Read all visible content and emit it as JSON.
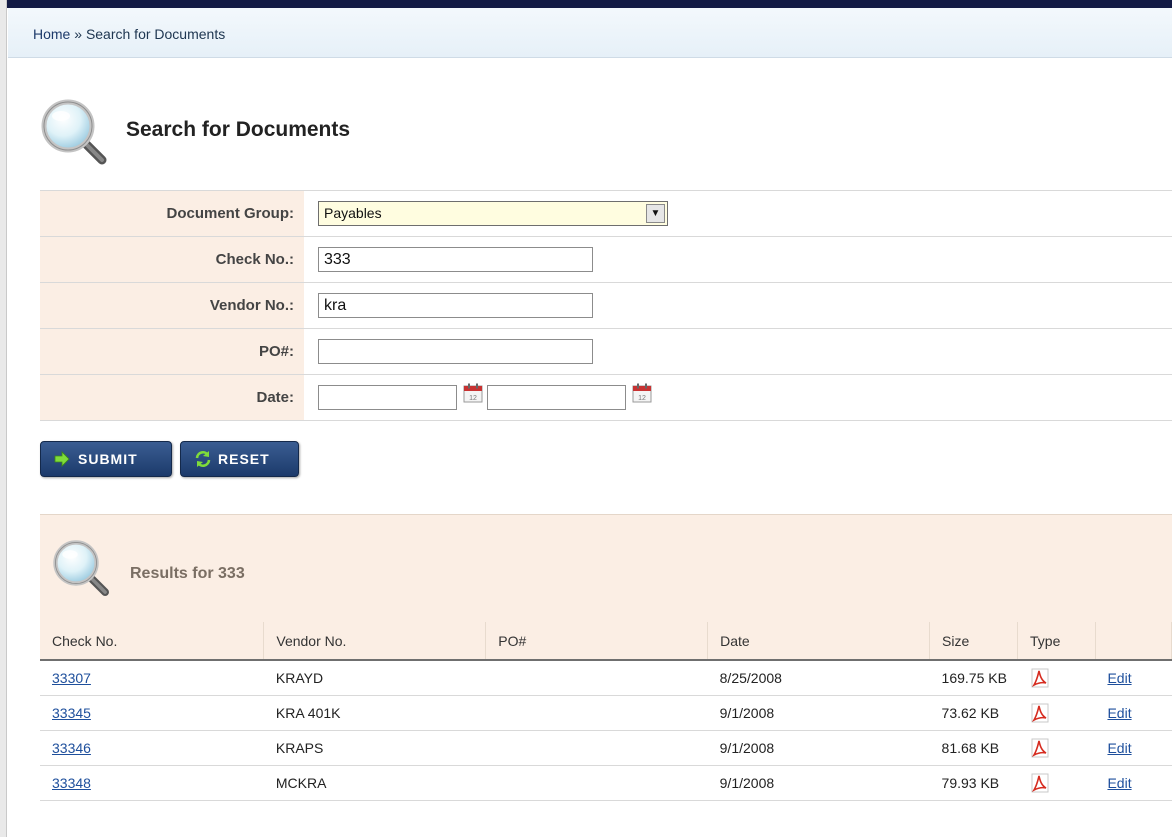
{
  "breadcrumb": {
    "home": "Home",
    "separator": "»",
    "current": "Search for Documents"
  },
  "page": {
    "title": "Search for Documents",
    "icon": "magnifier-icon"
  },
  "form": {
    "document_group": {
      "label": "Document Group:",
      "value": "Payables"
    },
    "check_no": {
      "label": "Check No.:",
      "value": "333"
    },
    "vendor_no": {
      "label": "Vendor No.:",
      "value": "kra"
    },
    "po": {
      "label": "PO#:",
      "value": ""
    },
    "date": {
      "label": "Date:",
      "from": "",
      "to": ""
    }
  },
  "buttons": {
    "submit": "SUBMIT",
    "reset": "RESET"
  },
  "results": {
    "heading": "Results for 333",
    "columns": [
      "Check No.",
      "Vendor No.",
      "PO#",
      "Date",
      "Size",
      "Type",
      ""
    ],
    "rows": [
      {
        "check_no": "33307",
        "vendor_no": "KRAYD",
        "po": "",
        "date": "8/25/2008",
        "size": "169.75 KB",
        "type": "pdf-icon",
        "action": "Edit"
      },
      {
        "check_no": "33345",
        "vendor_no": "KRA 401K",
        "po": "",
        "date": "9/1/2008",
        "size": "73.62 KB",
        "type": "pdf-icon",
        "action": "Edit"
      },
      {
        "check_no": "33346",
        "vendor_no": "KRAPS",
        "po": "",
        "date": "9/1/2008",
        "size": "81.68 KB",
        "type": "pdf-icon",
        "action": "Edit"
      },
      {
        "check_no": "33348",
        "vendor_no": "MCKRA",
        "po": "",
        "date": "9/1/2008",
        "size": "79.93 KB",
        "type": "pdf-icon",
        "action": "Edit"
      }
    ]
  },
  "colors": {
    "top_bar": "#131b45",
    "button": "#1c3a6b",
    "panel": "#fbeee4",
    "link": "#1e4f9c"
  }
}
